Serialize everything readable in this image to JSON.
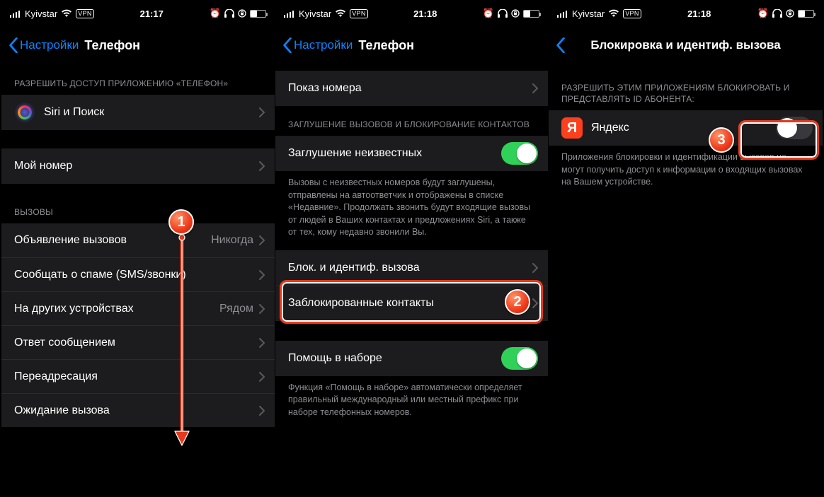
{
  "status": {
    "carrier": "Kyivstar",
    "vpn": "VPN",
    "time1": "21:17",
    "time2": "21:18",
    "time3": "21:18"
  },
  "screen1": {
    "back": "Настройки",
    "title": "Телефон",
    "section_allow": "РАЗРЕШИТЬ ДОСТУП ПРИЛОЖЕНИЮ «ТЕЛЕФОН»",
    "siri": "Siri и Поиск",
    "my_number": "Мой номер",
    "calls_header": "ВЫЗОВЫ",
    "rows": {
      "announce": "Объявление вызовов",
      "announce_val": "Никогда",
      "spam": "Сообщать о спаме (SMS/звонки)",
      "other_devices": "На других устройствах",
      "other_devices_val": "Рядом",
      "reply_msg": "Ответ сообщением",
      "forwarding": "Переадресация",
      "call_waiting": "Ожидание вызова"
    }
  },
  "screen2": {
    "back": "Настройки",
    "title": "Телефон",
    "show_number": "Показ номера",
    "silence_header": "ЗАГЛУШЕНИЕ ВЫЗОВОВ И БЛОКИРОВАНИЕ КОНТАКТОВ",
    "silence_unknown": "Заглушение неизвестных",
    "silence_footer": "Вызовы с неизвестных номеров будут заглушены, отправлены на автоответчик и отображены в списке «Недавние». Продолжать звонить будут входящие вызовы от людей в Ваших контактах и предложениях Siri, а также от тех, кому недавно звонили Вы.",
    "block_id": "Блок. и идентиф. вызова",
    "blocked_contacts": "Заблокированные контакты",
    "dial_assist": "Помощь в наборе",
    "dial_footer": "Функция «Помощь в наборе» автоматически определяет правильный международный или местный префикс при наборе телефонных номеров."
  },
  "screen3": {
    "title": "Блокировка и идентиф. вызова",
    "header": "РАЗРЕШИТЬ ЭТИМ ПРИЛОЖЕНИЯМ БЛОКИРОВАТЬ И ПРЕДСТАВЛЯТЬ ID АБОНЕНТА:",
    "yandex": "Яндекс",
    "footer": "Приложения блокировки и идентификации вызовов не могут получить доступ к информации о входящих вызовах на Вашем устройстве."
  },
  "steps": {
    "s1": "1",
    "s2": "2",
    "s3": "3"
  }
}
